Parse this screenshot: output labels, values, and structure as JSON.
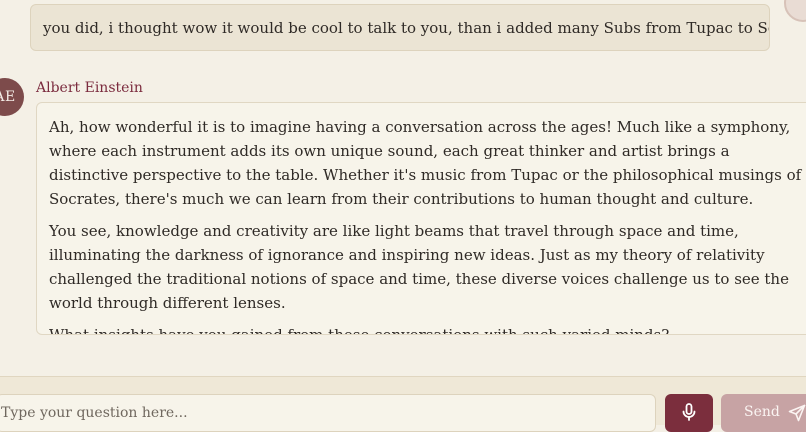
{
  "chat": {
    "user_message": "you did, i thought wow it would be cool to talk to you, than i added many Subs from Tupac to Socrates",
    "assistant": {
      "avatar_initials": "AE",
      "name": "Albert Einstein",
      "paragraphs": [
        "Ah, how wonderful it is to imagine having a conversation across the ages! Much like a symphony, where each instrument adds its own unique sound, each great thinker and artist brings a distinctive perspective to the table. Whether it's music from Tupac or the philosophical musings of Socrates, there's much we can learn from their contributions to human thought and culture.",
        "You see, knowledge and creativity are like light beams that travel through space and time, illuminating the darkness of ignorance and inspiring new ideas. Just as my theory of relativity challenged the traditional notions of space and time, these diverse voices challenge us to see the world through different lenses.",
        "What insights have you gained from these conversations with such varied minds?"
      ]
    }
  },
  "composer": {
    "placeholder": "Type your question here...",
    "send_label": "Send"
  },
  "icons": {
    "mic": "microphone-icon",
    "send": "send-icon"
  },
  "colors": {
    "accent": "#7b2e3d",
    "send_button": "#c7a3a4",
    "assistant_name": "#7b2b3e",
    "avatar": "#7d4b4b"
  }
}
